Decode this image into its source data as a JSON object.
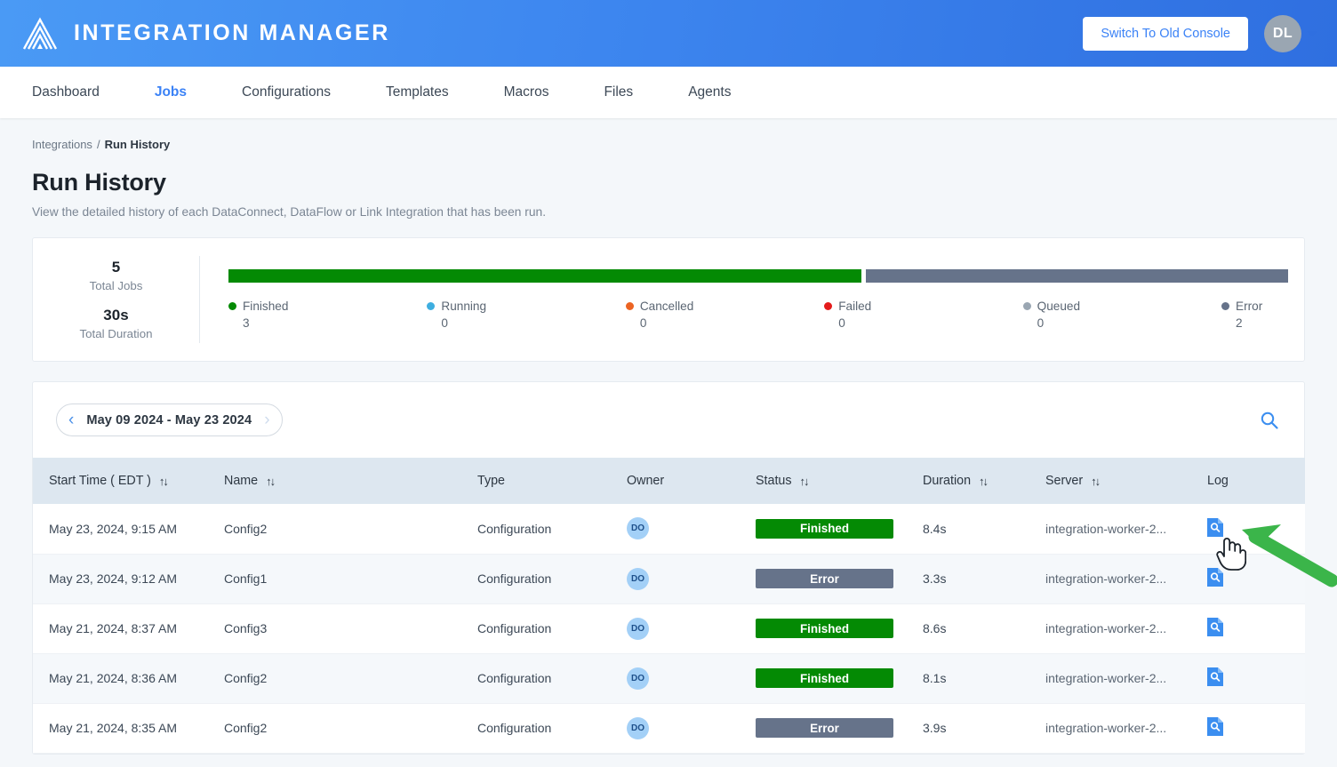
{
  "header": {
    "brand_name": "INTEGRATION MANAGER",
    "logo_icon": "triangle-chevron-logo",
    "switch_console_label": "Switch To Old Console",
    "avatar_initials": "DL",
    "avatar_caret_icon": "chevron-down-icon"
  },
  "nav": {
    "items": [
      {
        "label": "Dashboard",
        "active": false
      },
      {
        "label": "Jobs",
        "active": true
      },
      {
        "label": "Configurations",
        "active": false
      },
      {
        "label": "Templates",
        "active": false
      },
      {
        "label": "Macros",
        "active": false
      },
      {
        "label": "Files",
        "active": false
      },
      {
        "label": "Agents",
        "active": false
      }
    ]
  },
  "breadcrumb": {
    "parent": "Integrations",
    "separator": "/",
    "current": "Run History"
  },
  "page": {
    "title": "Run History",
    "subtitle": "View the detailed history of each DataConnect, DataFlow or Link Integration that has been run."
  },
  "summary": {
    "total_jobs_value": "5",
    "total_jobs_label": "Total Jobs",
    "total_duration_value": "30s",
    "total_duration_label": "Total Duration"
  },
  "chart_data": {
    "type": "bar",
    "title": "",
    "categories": [
      "Finished",
      "Running",
      "Cancelled",
      "Failed",
      "Queued",
      "Error"
    ],
    "values": [
      3,
      0,
      0,
      0,
      0,
      2
    ],
    "colors": [
      "#048a04",
      "#3eaee0",
      "#ec6423",
      "#e41b1b",
      "#9aa6b2",
      "#66738a"
    ],
    "total": 5,
    "orientation": "horizontal-stacked",
    "xlabel": "",
    "ylabel": "",
    "legend_position": "bottom"
  },
  "toolbar": {
    "prev_icon": "chevron-left-icon",
    "next_icon": "chevron-right-icon",
    "date_range": "May 09 2024 - May 23 2024",
    "search_icon": "search-icon"
  },
  "table": {
    "columns": [
      {
        "label": "Start Time ( EDT )",
        "sortable": true,
        "sort_icon": "sort-updown-icon"
      },
      {
        "label": "Name",
        "sortable": true,
        "sort_icon": "sort-updown-icon"
      },
      {
        "label": "Type",
        "sortable": false,
        "sort_icon": ""
      },
      {
        "label": "Owner",
        "sortable": false,
        "sort_icon": ""
      },
      {
        "label": "Status",
        "sortable": true,
        "sort_icon": "sort-updown-icon"
      },
      {
        "label": "Duration",
        "sortable": true,
        "sort_icon": "sort-updown-icon"
      },
      {
        "label": "Server",
        "sortable": true,
        "sort_icon": "sort-updown-icon"
      },
      {
        "label": "Log",
        "sortable": false,
        "sort_icon": ""
      }
    ],
    "rows": [
      {
        "start_time": "May 23, 2024, 9:15 AM",
        "name": "Config2",
        "type": "Configuration",
        "owner": "DO",
        "status": "Finished",
        "status_color": "#048a04",
        "duration": "8.4s",
        "server": "integration-worker-2...",
        "log_icon": "log-search-icon"
      },
      {
        "start_time": "May 23, 2024, 9:12 AM",
        "name": "Config1",
        "type": "Configuration",
        "owner": "DO",
        "status": "Error",
        "status_color": "#66738a",
        "duration": "3.3s",
        "server": "integration-worker-2...",
        "log_icon": "log-search-icon"
      },
      {
        "start_time": "May 21, 2024, 8:37 AM",
        "name": "Config3",
        "type": "Configuration",
        "owner": "DO",
        "status": "Finished",
        "status_color": "#048a04",
        "duration": "8.6s",
        "server": "integration-worker-2...",
        "log_icon": "log-search-icon"
      },
      {
        "start_time": "May 21, 2024, 8:36 AM",
        "name": "Config2",
        "type": "Configuration",
        "owner": "DO",
        "status": "Finished",
        "status_color": "#048a04",
        "duration": "8.1s",
        "server": "integration-worker-2...",
        "log_icon": "log-search-icon"
      },
      {
        "start_time": "May 21, 2024, 8:35 AM",
        "name": "Config2",
        "type": "Configuration",
        "owner": "DO",
        "status": "Error",
        "status_color": "#66738a",
        "duration": "3.9s",
        "server": "integration-worker-2...",
        "log_icon": "log-search-icon"
      }
    ]
  },
  "annotations": {
    "pointer_icon": "hand-cursor-icon",
    "arrow_icon": "green-arrow-icon",
    "arrow_color": "#3bb54a"
  }
}
